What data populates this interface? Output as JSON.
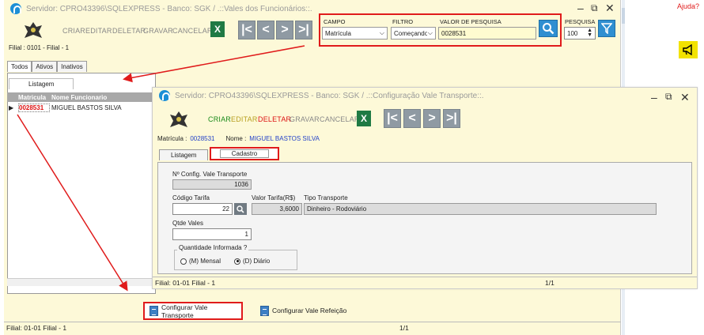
{
  "outer": {
    "title": "Servidor: CPRO43396\\SQLEXPRESS - Banco: SGK / .::Vales dos Funcionários::.",
    "toolbar": {
      "criar": "CRIAR",
      "editar": "EDITAR",
      "deletar": "DELETAR",
      "gravar": "GRAVAR",
      "cancelar": "CANCELAR"
    },
    "search": {
      "campo_label": "CAMPO",
      "campo_value": "Matrícula",
      "filtro_label": "FILTRO",
      "filtro_value": "Começando",
      "valor_label": "VALOR DE PESQUISA",
      "valor_value": "0028531",
      "pesquisa_label": "PESQUISA",
      "pesquisa_value": "100"
    },
    "filial": "Filial : 0101 - Filial - 1",
    "tabs": [
      "Todos",
      "Ativos",
      "Inativos"
    ],
    "subtab": "Listagem",
    "grid": {
      "col_matricula": "Matricula",
      "col_nome": "Nome Funcionario",
      "rows": [
        {
          "matricula": "0028531",
          "nome": "MIGUEL BASTOS SILVA"
        }
      ]
    },
    "buttons": {
      "vale_transporte": "Configurar Vale Transporte",
      "vale_refeicao": "Configurar Vale Refeição"
    },
    "status": {
      "filial": "Filial: 01-01 Filial - 1",
      "page": "1/1"
    }
  },
  "help_link": "Ajuda?",
  "inner": {
    "title": "Servidor: CPRO43396\\SQLEXPRESS - Banco: SGK / .::Configuração Vale Transporte::.",
    "toolbar": {
      "criar": "CRIAR",
      "editar": "EDITAR",
      "deletar": "DELETAR",
      "gravar": "GRAVAR",
      "cancelar": "CANCELAR"
    },
    "matricula_label": "Matrícula :",
    "matricula_value": "0028531",
    "nome_label": "Nome :",
    "nome_value": "MIGUEL BASTOS SILVA",
    "tabs": [
      "Listagem",
      "Cadastro"
    ],
    "form": {
      "config_label": "Nº Config. Vale Transporte",
      "config_value": "1036",
      "codigo_label": "Código Tarifa",
      "codigo_value": "22",
      "valor_label": "Valor Tarifa(R$)",
      "valor_value": "3,6000",
      "tipo_label": "Tipo Transporte",
      "tipo_value": "Dinheiro - Rodoviário",
      "qtde_label": "Qtde Vales",
      "qtde_value": "1",
      "quantidade_label": "Quantidade Informada ?",
      "mensal_label": "(M) Mensal",
      "diario_label": "(D) Diário"
    },
    "status": {
      "filial": "Filial: 01-01 Filial - 1",
      "page": "1/1"
    }
  },
  "colors": {
    "accent_blue": "#2f8fd1",
    "highlight_red": "#e01b1b",
    "window_bg": "#fdf9d8"
  }
}
